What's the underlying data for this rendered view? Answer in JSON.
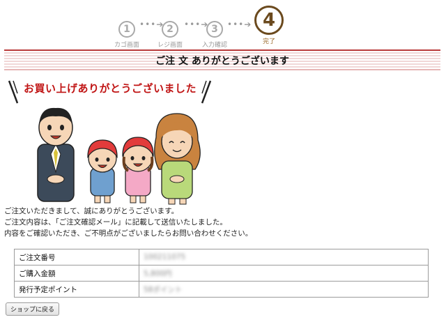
{
  "steps": [
    {
      "num": "1",
      "label": "カゴ画面"
    },
    {
      "num": "2",
      "label": "レジ画面"
    },
    {
      "num": "3",
      "label": "入力確認"
    },
    {
      "num": "4",
      "label": "完了"
    }
  ],
  "page_title": "ご注 文 ありがとうございます",
  "banner": "お買い上げありがとうございました",
  "message": {
    "line1": "ご注文いただきまして、誠にありがとうございます。",
    "line2": "ご注文内容は、「ご注文確認メール」に記載して送信いたしました。",
    "line3": "内容をご確認いただき、ご不明点がございましたらお問い合わせください。"
  },
  "order_info": {
    "rows": [
      {
        "label": "ご注文番号",
        "value": "100211075"
      },
      {
        "label": "ご購入金額",
        "value": "5,800円"
      },
      {
        "label": "発行予定ポイント",
        "value": "58ポイント"
      }
    ]
  },
  "back_button": "ショップに戻る",
  "colors": {
    "accent": "#b93a3a",
    "banner": "#c01414",
    "step_active": "#6b4a1e"
  }
}
